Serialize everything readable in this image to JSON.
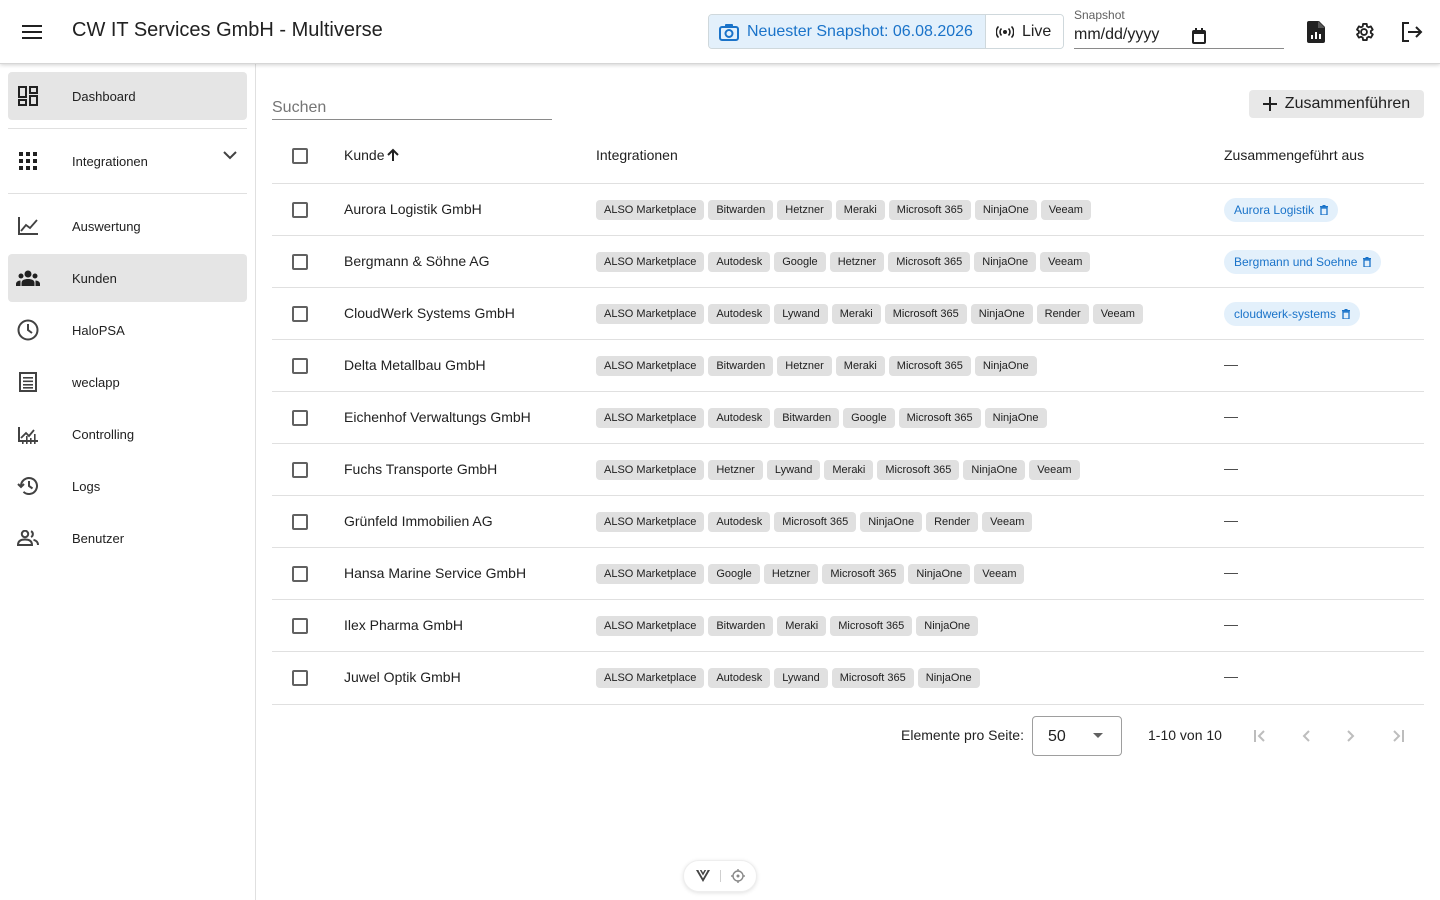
{
  "app": {
    "title": "CW IT Services GmbH - Multiverse"
  },
  "header": {
    "snapshot_button": "Neuester Snapshot: 06.08.2026",
    "live_button": "Live",
    "snapshot_field_label": "Snapshot",
    "snapshot_field_placeholder": "mm/dd/yyyy",
    "icons": [
      "menu-icon",
      "camera-icon",
      "live-broadcast-icon",
      "calendar-icon",
      "report-file-icon",
      "gear-icon",
      "logout-icon"
    ]
  },
  "sidebar": {
    "items": [
      {
        "label": "Dashboard",
        "icon": "dashboard-icon",
        "active": true
      },
      {
        "label": "Integrationen",
        "icon": "apps-grid-icon",
        "active": false,
        "expandable": true
      },
      {
        "label": "Auswertung",
        "icon": "line-chart-icon",
        "active": false
      },
      {
        "label": "Kunden",
        "icon": "people-icon",
        "active": true
      },
      {
        "label": "HaloPSA",
        "icon": "clock-icon",
        "active": false
      },
      {
        "label": "weclapp",
        "icon": "list-document-icon",
        "active": false
      },
      {
        "label": "Controlling",
        "icon": "stock-chart-icon",
        "active": false
      },
      {
        "label": "Logs",
        "icon": "history-icon",
        "active": false
      },
      {
        "label": "Benutzer",
        "icon": "users-icon",
        "active": false
      }
    ]
  },
  "main": {
    "search_placeholder": "Suchen",
    "merge_button": "Zusammenführen",
    "table": {
      "columns": [
        "Kunde",
        "Integrationen",
        "Zusammengeführt aus"
      ],
      "sort": {
        "column": "Kunde",
        "direction": "ascending"
      },
      "rows": [
        {
          "name": "Aurora Logistik GmbH",
          "integrations": [
            "ALSO Marketplace",
            "Bitwarden",
            "Hetzner",
            "Meraki",
            "Microsoft 365",
            "NinjaOne",
            "Veeam"
          ],
          "merged_from": "Aurora Logistik"
        },
        {
          "name": "Bergmann & Söhne AG",
          "integrations": [
            "ALSO Marketplace",
            "Autodesk",
            "Google",
            "Hetzner",
            "Microsoft 365",
            "NinjaOne",
            "Veeam"
          ],
          "merged_from": "Bergmann und Soehne"
        },
        {
          "name": "CloudWerk Systems GmbH",
          "integrations": [
            "ALSO Marketplace",
            "Autodesk",
            "Lywand",
            "Meraki",
            "Microsoft 365",
            "NinjaOne",
            "Render",
            "Veeam"
          ],
          "merged_from": "cloudwerk-systems"
        },
        {
          "name": "Delta Metallbau GmbH",
          "integrations": [
            "ALSO Marketplace",
            "Bitwarden",
            "Hetzner",
            "Meraki",
            "Microsoft 365",
            "NinjaOne"
          ],
          "merged_from": "—"
        },
        {
          "name": "Eichenhof Verwaltungs GmbH",
          "integrations": [
            "ALSO Marketplace",
            "Autodesk",
            "Bitwarden",
            "Google",
            "Microsoft 365",
            "NinjaOne"
          ],
          "merged_from": "—"
        },
        {
          "name": "Fuchs Transporte GmbH",
          "integrations": [
            "ALSO Marketplace",
            "Hetzner",
            "Lywand",
            "Meraki",
            "Microsoft 365",
            "NinjaOne",
            "Veeam"
          ],
          "merged_from": "—"
        },
        {
          "name": "Grünfeld Immobilien AG",
          "integrations": [
            "ALSO Marketplace",
            "Autodesk",
            "Microsoft 365",
            "NinjaOne",
            "Render",
            "Veeam"
          ],
          "merged_from": "—"
        },
        {
          "name": "Hansa Marine Service GmbH",
          "integrations": [
            "ALSO Marketplace",
            "Google",
            "Hetzner",
            "Microsoft 365",
            "NinjaOne",
            "Veeam"
          ],
          "merged_from": "—"
        },
        {
          "name": "Ilex Pharma GmbH",
          "integrations": [
            "ALSO Marketplace",
            "Bitwarden",
            "Meraki",
            "Microsoft 365",
            "NinjaOne"
          ],
          "merged_from": "—"
        },
        {
          "name": "Juwel Optik GmbH",
          "integrations": [
            "ALSO Marketplace",
            "Autodesk",
            "Lywand",
            "Microsoft 365",
            "NinjaOne"
          ],
          "merged_from": "—"
        }
      ]
    },
    "paginator": {
      "label": "Elemente pro Seite:",
      "page_size": "50",
      "range": "1-10 von 10"
    }
  },
  "colors": {
    "accent": "#1a73c9",
    "accent_bg": "#e3f0fb",
    "active_nav_bg": "#e5e5e5",
    "chip_bg": "#e0e0e0"
  }
}
